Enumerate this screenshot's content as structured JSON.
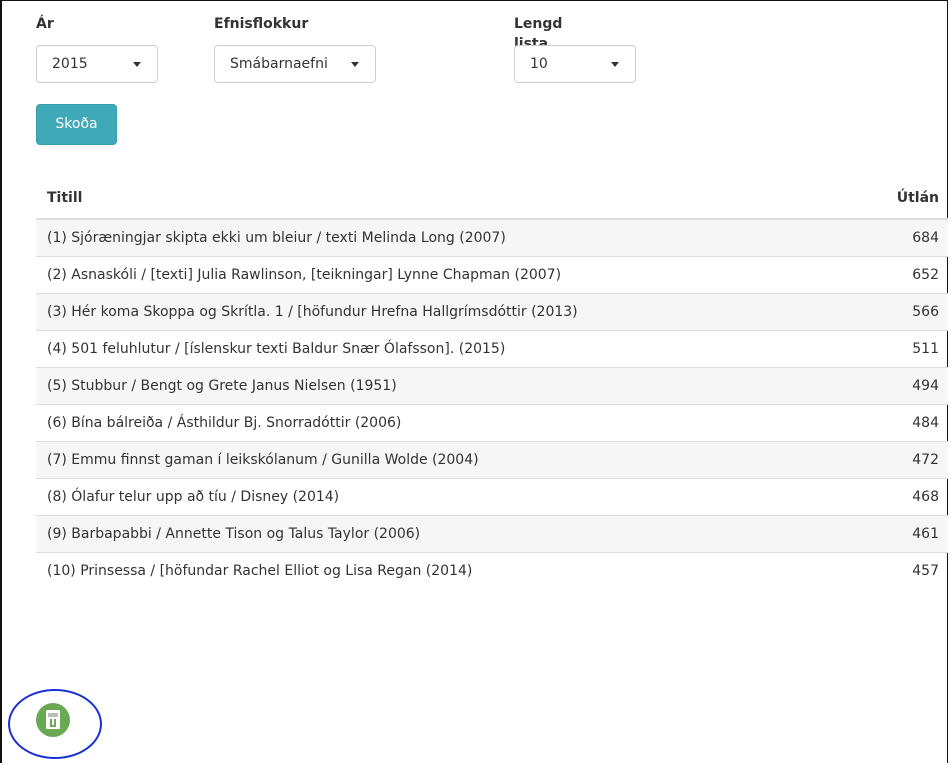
{
  "filters": {
    "year": {
      "label": "Ár",
      "value": "2015"
    },
    "category": {
      "label": "Efnisflokkur",
      "value": "Smábarnaefni"
    },
    "list_length": {
      "label": "Lengd lista",
      "value": "10"
    }
  },
  "view_button_label": "Skoða",
  "table": {
    "headers": {
      "title": "Titill",
      "loans": "Útlán"
    },
    "rows": [
      {
        "title": "(1) Sjóræningjar skipta ekki um bleiur / texti Melinda Long (2007)",
        "loans": "684"
      },
      {
        "title": "(2) Asnaskóli / [texti] Julia Rawlinson, [teikningar] Lynne Chapman (2007)",
        "loans": "652"
      },
      {
        "title": "(3) Hér koma Skoppa og Skrítla. 1 / [höfundur Hrefna Hallgrímsdóttir (2013)",
        "loans": "566"
      },
      {
        "title": "(4) 501 feluhlutur / [íslenskur texti Baldur Snær Ólafsson]. (2015)",
        "loans": "511"
      },
      {
        "title": "(5) Stubbur / Bengt og Grete Janus Nielsen (1951)",
        "loans": "494"
      },
      {
        "title": "(6) Bína bálreiða / Ásthildur Bj. Snorradóttir (2006)",
        "loans": "484"
      },
      {
        "title": "(7) Emmu finnst gaman í leikskólanum / Gunilla Wolde (2004)",
        "loans": "472"
      },
      {
        "title": "(8) Ólafur telur upp að tíu / Disney (2014)",
        "loans": "468"
      },
      {
        "title": "(9) Barbapabbi / Annette Tison og Talus Taylor (2006)",
        "loans": "461"
      },
      {
        "title": "(10) Prinsessa / [höfundar Rachel Elliot og Lisa Regan (2014)",
        "loans": "457"
      }
    ]
  },
  "export": {
    "icon": "excel-download-icon"
  },
  "colors": {
    "button": "#3fa9b8",
    "export_icon": "#6aa853",
    "annotation": "#1a2fd6"
  }
}
